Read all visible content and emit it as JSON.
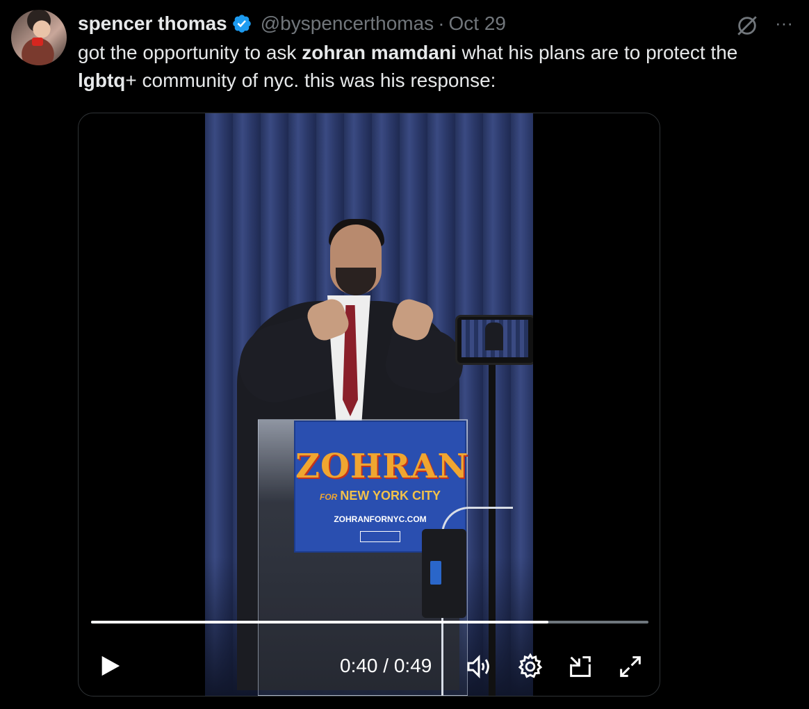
{
  "tweet": {
    "author_name": "spencer thomas",
    "handle": "@byspencerthomas",
    "separator": "·",
    "date": "Oct 29",
    "text_parts": [
      {
        "text": "got the opportunity to ask ",
        "bold": false
      },
      {
        "text": "zohran mamdani",
        "bold": true
      },
      {
        "text": " what his plans are to protect the ",
        "bold": false
      },
      {
        "text": "lgbtq",
        "bold": true
      },
      {
        "text": "+ community of nyc. this was his response:",
        "bold": false
      }
    ]
  },
  "icons": {
    "verified": "verified-badge-icon",
    "grok": "grok-icon",
    "more": "more-icon",
    "play": "play-icon",
    "volume": "volume-icon",
    "settings": "settings-icon",
    "popout": "popout-icon",
    "fullscreen": "fullscreen-icon"
  },
  "video": {
    "sign_main": "ZOHRAN",
    "sign_for": "FOR",
    "sign_city": "NEW YORK CITY",
    "sign_url": "ZOHRANFORNYC.COM",
    "elapsed": "0:40",
    "duration": "0:49",
    "time_separator": " / ",
    "progress_fraction": 0.82
  },
  "colors": {
    "verified_blue": "#1d9bf0",
    "muted_text": "#71767b",
    "background": "#000000"
  }
}
